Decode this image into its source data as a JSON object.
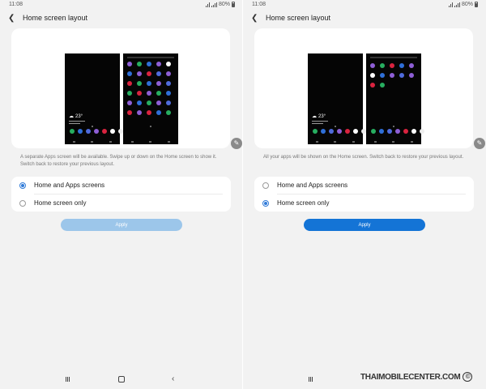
{
  "screens": [
    {
      "status": {
        "time": "11:08",
        "battery": "80%"
      },
      "header": {
        "back_icon": "back-arrow-icon",
        "title": "Home screen layout"
      },
      "preview": {
        "weather_temp": "23°",
        "dock_colors": [
          "#27ae60",
          "#2f6fd8",
          "#4f6bdc",
          "#8e5fd6",
          "#d9233f",
          "#ffffff",
          "#eeeeee"
        ],
        "grid_colors": []
      },
      "description": "A separate Apps screen will be available. Swipe up or down on the Home screen to show it. Switch back to restore your previous layout.",
      "options": [
        {
          "label": "Home and Apps screens",
          "selected": true
        },
        {
          "label": "Home screen only",
          "selected": false
        }
      ],
      "apply_label": "Apply",
      "apply_enabled": false
    },
    {
      "status": {
        "time": "11:08",
        "battery": "80%"
      },
      "header": {
        "back_icon": "back-arrow-icon",
        "title": "Home screen layout"
      },
      "preview": {
        "weather_temp": "23°",
        "dock_colors": [
          "#27ae60",
          "#2f6fd8",
          "#4f6bdc",
          "#8e5fd6",
          "#d9233f",
          "#ffffff",
          "#eeeeee"
        ]
      },
      "description": "All your apps will be shown on the Home screen. Switch back to restore your previous layout.",
      "options": [
        {
          "label": "Home and Apps screens",
          "selected": false
        },
        {
          "label": "Home screen only",
          "selected": true
        }
      ],
      "apply_label": "Apply",
      "apply_enabled": true
    }
  ],
  "watermark": "THAIMOBILECENTER.COM",
  "watermark_symbol": "©",
  "colors": {
    "accent": "#2f7ad8",
    "apply_enabled": "#1474d6",
    "apply_disabled": "#9cc6ea"
  }
}
